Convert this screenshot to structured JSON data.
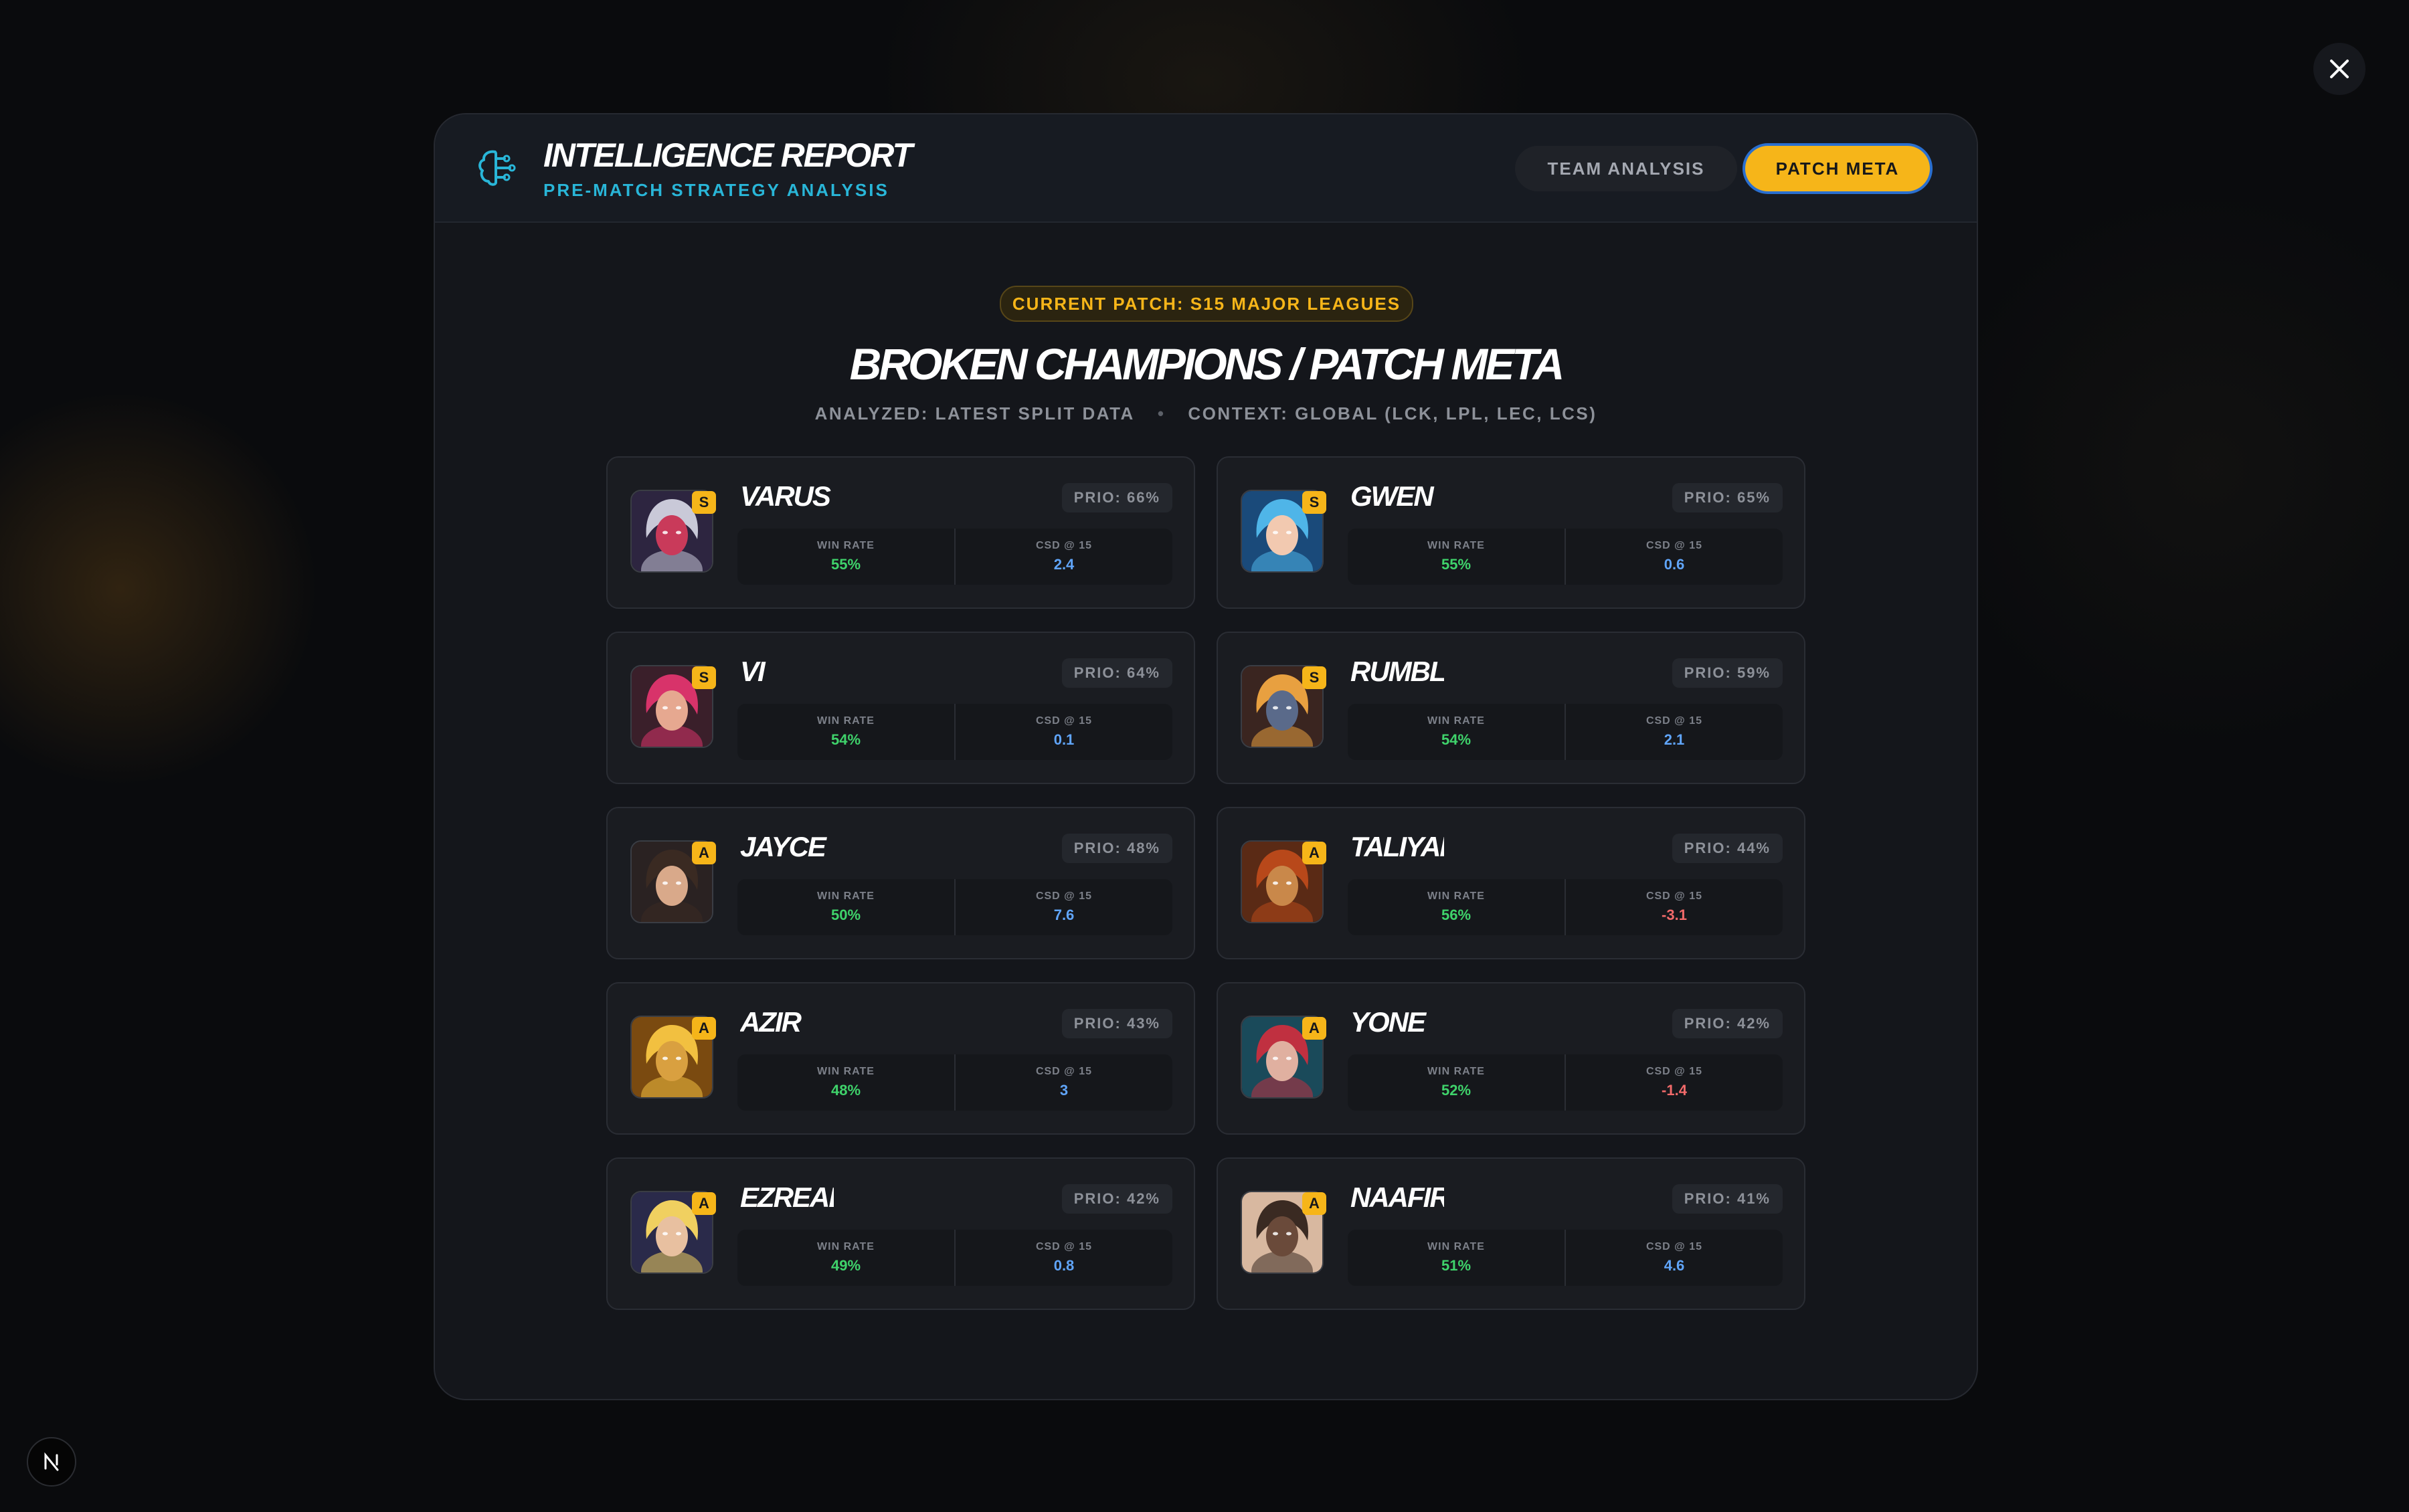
{
  "header": {
    "title": "INTELLIGENCE REPORT",
    "subtitle": "PRE-MATCH STRATEGY ANALYSIS",
    "tabs": [
      {
        "label": "TEAM ANALYSIS",
        "active": false
      },
      {
        "label": "PATCH META",
        "active": true
      }
    ]
  },
  "content": {
    "patch_label": "CURRENT PATCH: S15 MAJOR LEAGUES",
    "heading": "BROKEN CHAMPIONS / PATCH META",
    "analyzed": "ANALYZED: LATEST SPLIT DATA",
    "context": "CONTEXT: GLOBAL (LCK, LPL, LEC, LCS)",
    "win_rate_label": "WIN RATE",
    "csd_label": "CSD @ 15"
  },
  "champions": [
    {
      "name": "VARUS",
      "tier": "S",
      "prio": "PRIO: 66%",
      "win_rate": "55%",
      "csd": "2.4",
      "csd_color": "blue",
      "portrait": {
        "bg": "#2d2540",
        "skin": "#c93a5a",
        "hair": "#c9c9d8"
      }
    },
    {
      "name": "GWEN",
      "tier": "S",
      "prio": "PRIO: 65%",
      "win_rate": "55%",
      "csd": "0.6",
      "csd_color": "blue",
      "portrait": {
        "bg": "#1a4a7a",
        "skin": "#f2c9b0",
        "hair": "#4fb5e8"
      }
    },
    {
      "name": "VI",
      "tier": "S",
      "prio": "PRIO: 64%",
      "win_rate": "54%",
      "csd": "0.1",
      "csd_color": "blue",
      "portrait": {
        "bg": "#3a1f2a",
        "skin": "#e6a890",
        "hair": "#d8336a"
      }
    },
    {
      "name": "RUMBLE",
      "tier": "S",
      "prio": "PRIO: 59%",
      "win_rate": "54%",
      "csd": "2.1",
      "csd_color": "blue",
      "portrait": {
        "bg": "#3a2520",
        "skin": "#5a6a8a",
        "hair": "#e8a040"
      }
    },
    {
      "name": "JAYCE",
      "tier": "A",
      "prio": "PRIO: 48%",
      "win_rate": "50%",
      "csd": "7.6",
      "csd_color": "blue",
      "portrait": {
        "bg": "#2a2222",
        "skin": "#d9a98a",
        "hair": "#3a2a22"
      }
    },
    {
      "name": "TALIYAH",
      "tier": "A",
      "prio": "PRIO: 44%",
      "win_rate": "56%",
      "csd": "-3.1",
      "csd_color": "red",
      "portrait": {
        "bg": "#5a2a15",
        "skin": "#c9884a",
        "hair": "#b8481a"
      }
    },
    {
      "name": "AZIR",
      "tier": "A",
      "prio": "PRIO: 43%",
      "win_rate": "48%",
      "csd": "3",
      "csd_color": "blue",
      "portrait": {
        "bg": "#7a4a10",
        "skin": "#d9a040",
        "hair": "#f2c040"
      }
    },
    {
      "name": "YONE",
      "tier": "A",
      "prio": "PRIO: 42%",
      "win_rate": "52%",
      "csd": "-1.4",
      "csd_color": "red",
      "portrait": {
        "bg": "#1a4a5a",
        "skin": "#e0b0a0",
        "hair": "#c03040"
      }
    },
    {
      "name": "EZREAL",
      "tier": "A",
      "prio": "PRIO: 42%",
      "win_rate": "49%",
      "csd": "0.8",
      "csd_color": "blue",
      "portrait": {
        "bg": "#2a2a4a",
        "skin": "#e8c0a0",
        "hair": "#f0d060"
      }
    },
    {
      "name": "NAAFIRI",
      "tier": "A",
      "prio": "PRIO: 41%",
      "win_rate": "51%",
      "csd": "4.6",
      "csd_color": "blue",
      "portrait": {
        "bg": "#d8b8a0",
        "skin": "#6a4a3a",
        "hair": "#3a2a22"
      }
    }
  ]
}
